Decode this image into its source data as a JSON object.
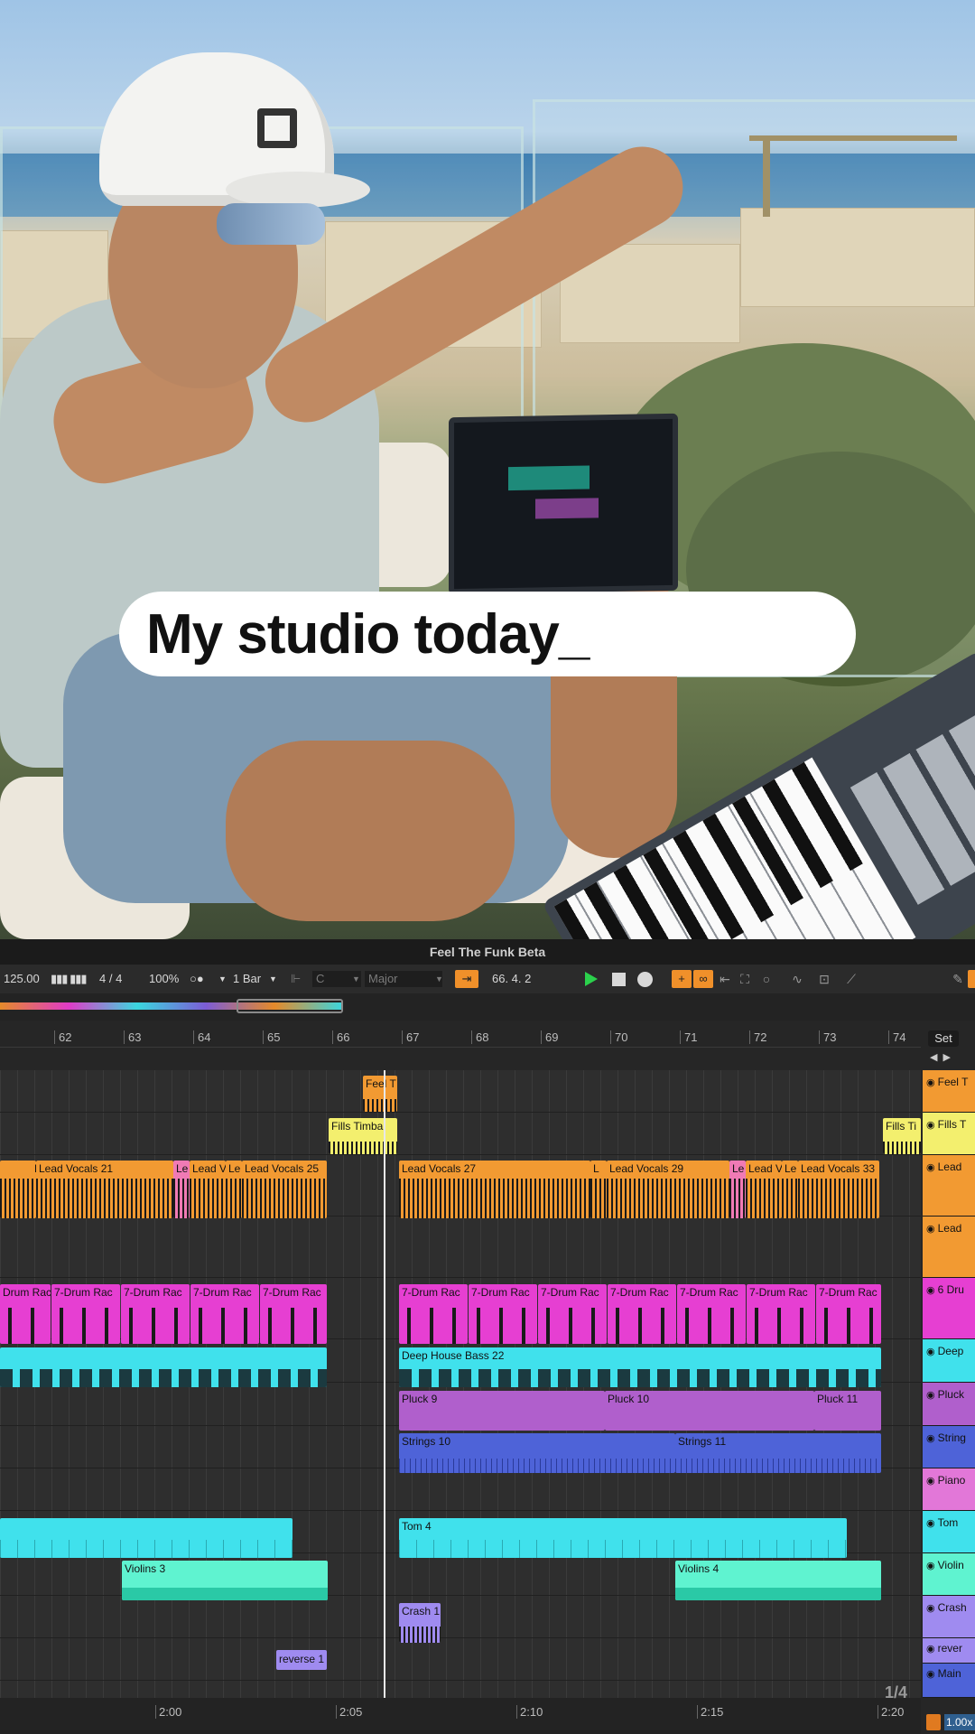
{
  "caption": "My studio today_",
  "daw": {
    "title": "Feel The Funk Beta",
    "controls": {
      "tempo": "125.00",
      "signature": "4 / 4",
      "zoom_pct": "100%",
      "metronome": "○●",
      "quantize": "1 Bar",
      "key": "C",
      "scale": "Major",
      "position": "66.  4.  2"
    },
    "set_label": "Set",
    "ruler": [
      "62",
      "63",
      "64",
      "65",
      "66",
      "67",
      "68",
      "69",
      "70",
      "71",
      "72",
      "73",
      "74"
    ],
    "timeline": [
      "2:00",
      "2:05",
      "2:10",
      "2:15",
      "2:20"
    ],
    "pager": "1/4",
    "zoom_badge": "1.00x",
    "clips": {
      "feel_t": "Feel T",
      "fills_left": "Fills Timbal",
      "fills_right": "Fills Ti",
      "vocals": [
        "L",
        "Lead Vocals 21",
        "Le",
        "Lead V",
        "Le",
        "Lead Vocals 25",
        "Lead Vocals 27",
        "L",
        "Lead Vocals 29",
        "Le",
        "Lead V",
        "Le",
        "Lead Vocals 33"
      ],
      "drums": [
        "Drum Rac",
        "7-Drum Rac",
        "7-Drum Rac",
        "7-Drum Rac",
        "7-Drum Rac",
        "7-Drum Rac",
        "7-Drum Rac",
        "7-Drum Rac",
        "7-Drum Rac",
        "7-Drum Rac",
        "7-Drum Rac",
        "7-Drum Rac"
      ],
      "bass": "Deep House Bass 22",
      "pluck": [
        "Pluck 9",
        "Pluck 10",
        "Pluck 11"
      ],
      "strings": [
        "Strings 10",
        "Strings 11"
      ],
      "tom": "Tom 4",
      "violins": [
        "Violins 3",
        "Violins 4"
      ],
      "crash": "Crash 1",
      "reverse": "reverse 1"
    },
    "tracks": [
      "Feel T",
      "Fills T",
      "Lead",
      "Lead",
      "6 Dru",
      "Deep",
      "Pluck",
      "String",
      "Piano",
      "Tom",
      "Violin",
      "Crash",
      "rever",
      "Main"
    ],
    "colors": {
      "orange": "#f29a32",
      "yellow": "#f3ef6e",
      "magenta": "#e63fd2",
      "cyan": "#40e1ec",
      "purple": "#b05fcc",
      "blue": "#4e63d8",
      "lilac": "#9f8bf0",
      "pink": "#f07ab5",
      "aqua": "#5ff3d0"
    }
  }
}
